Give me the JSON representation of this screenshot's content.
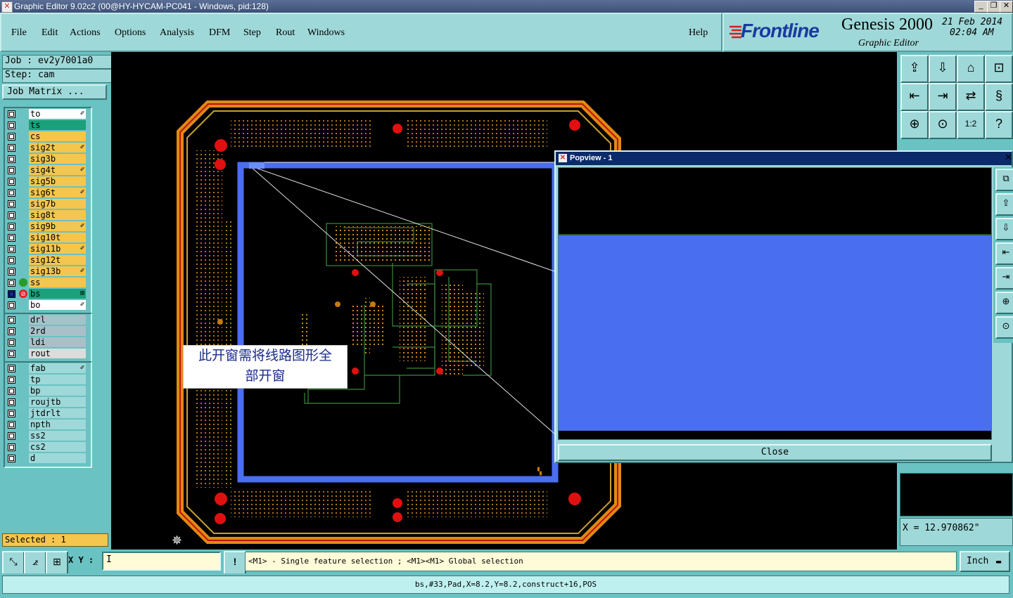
{
  "window": {
    "title": "Graphic Editor 9.02c2 (00@HY-HYCAM-PC041 - Windows, pid:128)",
    "buttons": [
      "_",
      "❐",
      "✕"
    ]
  },
  "menu": {
    "items": [
      "File",
      "Edit",
      "Actions",
      "Options",
      "Analysis",
      "DFM",
      "Step",
      "Rout",
      "Windows"
    ],
    "help": "Help"
  },
  "branding": {
    "logo": "Frontline",
    "product": "Genesis 2000",
    "subtitle": "Graphic Editor",
    "date": "21 Feb 2014",
    "time": "02:04 AM"
  },
  "job": {
    "job_label": "Job : ev2y7001a0",
    "step_label": "Step: cam",
    "matrix_button": "Job Matrix ..."
  },
  "layers": {
    "group1": [
      {
        "name": "to",
        "color": "#ffffff",
        "mark": "✐"
      },
      {
        "name": "ts",
        "color": "#1aa07a",
        "mark": ""
      },
      {
        "name": "cs",
        "color": "#f4c64e",
        "mark": ""
      },
      {
        "name": "sig2t",
        "color": "#f4c64e",
        "mark": "✐"
      },
      {
        "name": "sig3b",
        "color": "#f4c64e",
        "mark": ""
      },
      {
        "name": "sig4t",
        "color": "#f4c64e",
        "mark": "✐"
      },
      {
        "name": "sig5b",
        "color": "#f4c64e",
        "mark": ""
      },
      {
        "name": "sig6t",
        "color": "#f4c64e",
        "mark": "✐"
      },
      {
        "name": "sig7b",
        "color": "#f4c64e",
        "mark": ""
      },
      {
        "name": "sig8t",
        "color": "#f4c64e",
        "mark": ""
      },
      {
        "name": "sig9b",
        "color": "#f4c64e",
        "mark": "✐"
      },
      {
        "name": "sig10t",
        "color": "#f4c64e",
        "mark": ""
      },
      {
        "name": "sig11b",
        "color": "#f4c64e",
        "mark": "✐"
      },
      {
        "name": "sig12t",
        "color": "#f4c64e",
        "mark": ""
      },
      {
        "name": "sig13b",
        "color": "#f4c64e",
        "mark": "✐"
      },
      {
        "name": "ss",
        "color": "#f4c64e",
        "mark": ""
      },
      {
        "name": "bs",
        "color": "#1aa07a",
        "mark": "⊞"
      },
      {
        "name": "bo",
        "color": "#ffffff",
        "mark": "✐"
      }
    ],
    "group2": [
      {
        "name": "drl",
        "color": "#a9c0c8",
        "mark": ""
      },
      {
        "name": "2rd",
        "color": "#a9c0c8",
        "mark": ""
      },
      {
        "name": "ldi",
        "color": "#a9c0c8",
        "mark": ""
      },
      {
        "name": "rout",
        "color": "#dcdcdc",
        "mark": ""
      }
    ],
    "group3": [
      {
        "name": "fab",
        "color": "#9fd8d8",
        "mark": "✐"
      },
      {
        "name": "tp",
        "color": "#9fd8d8",
        "mark": ""
      },
      {
        "name": "bp",
        "color": "#9fd8d8",
        "mark": ""
      },
      {
        "name": "roujtb",
        "color": "#9fd8d8",
        "mark": ""
      },
      {
        "name": "jtdrlt",
        "color": "#9fd8d8",
        "mark": ""
      },
      {
        "name": "npth",
        "color": "#9fd8d8",
        "mark": ""
      },
      {
        "name": "ss2",
        "color": "#9fd8d8",
        "mark": ""
      },
      {
        "name": "cs2",
        "color": "#9fd8d8",
        "mark": ""
      },
      {
        "name": "d",
        "color": "#9fd8d8",
        "mark": ""
      }
    ]
  },
  "selected_text": "Selected : 1",
  "popview": {
    "title": "Popview - 1",
    "close": "Close"
  },
  "callout": {
    "line1": "此开窗需将线路图形全",
    "line2": "部开窗"
  },
  "coordinates": {
    "x_readout": "X = 12.970862\""
  },
  "bottom": {
    "xy_label": "X Y :",
    "xy_value": "I",
    "alert_icon": "!",
    "hint": "<M1> - Single feature selection ; <M1><M1> Global selection",
    "unit": "Inch"
  },
  "status_line": "bs,#33,Pad,X=8.2,Y=8.2,construct+16,POS",
  "right_toolbar_icons": [
    "fit-icon",
    "zoom-box-icon",
    "home-icon",
    "pan-icon",
    "pan-left-icon",
    "pan-right-icon",
    "mirror-icon",
    "snap-icon",
    "zoom-fit-icon",
    "center-icon",
    "scale-icon",
    "help-icon"
  ],
  "popview_side_icons": [
    "copy-icon",
    "up-icon",
    "down-icon",
    "left-icon",
    "right-icon",
    "zoom-out-icon",
    "zoom-in-icon"
  ]
}
